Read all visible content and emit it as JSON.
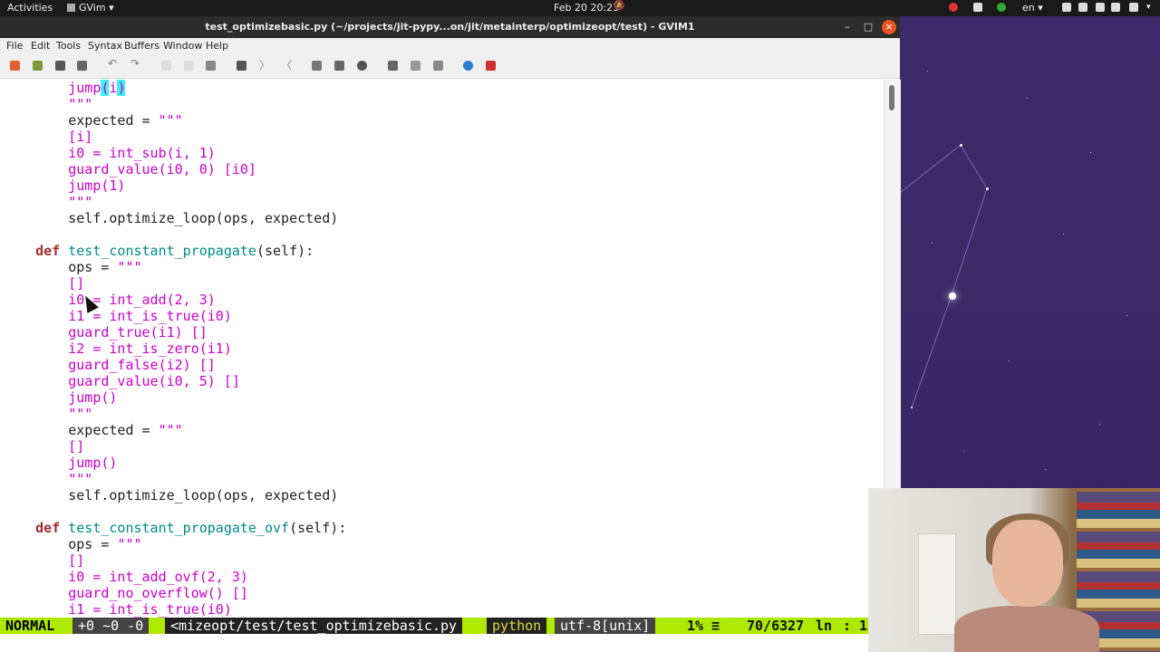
{
  "topbar": {
    "activities": "Activities",
    "app": "GVim ▾",
    "clock": "Feb 20  20:23",
    "language": "en ▾"
  },
  "window": {
    "title": "test_optimizebasic.py (~/projects/jit-pypy...on/jit/metainterp/optimizeopt/test) - GVIM1",
    "minimize": "–",
    "maximize": "□",
    "close": "×"
  },
  "menu": {
    "file": "File",
    "edit": "Edit",
    "tools": "Tools",
    "syntax": "Syntax",
    "buffers": "Buffers",
    "window": "Window",
    "help": "Help"
  },
  "toolbar_icons": [
    "open-icon",
    "save-session-icon",
    "save-icon",
    "print-icon",
    "undo-icon",
    "redo-icon",
    "cut-icon",
    "copy-icon",
    "paste-icon",
    "find-replace-icon",
    "find-next-icon",
    "find-prev-icon",
    "load-session-icon",
    "save-session2-icon",
    "run-script-icon",
    "make-icon",
    "ctags-icon",
    "jump-tag-icon",
    "help-icon",
    "find-help-icon"
  ],
  "code": [
    "        jump(i)",
    "        \"\"\"",
    "        expected = \"\"\"",
    "        [i]",
    "        i0 = int_sub(i, 1)",
    "        guard_value(i0, 0) [i0]",
    "        jump(1)",
    "        \"\"\"",
    "        self.optimize_loop(ops, expected)",
    "",
    "    def test_constant_propagate(self):",
    "        ops = \"\"\"",
    "        []",
    "        i0 = int_add(2, 3)",
    "        i1 = int_is_true(i0)",
    "        guard_true(i1) []",
    "        i2 = int_is_zero(i1)",
    "        guard_false(i2) []",
    "        guard_value(i0, 5) []",
    "        jump()",
    "        \"\"\"",
    "        expected = \"\"\"",
    "        []",
    "        jump()",
    "        \"\"\"",
    "        self.optimize_loop(ops, expected)",
    "",
    "    def test_constant_propagate_ovf(self):",
    "        ops = \"\"\"",
    "        []",
    "        i0 = int_add_ovf(2, 3)",
    "        guard_no_overflow() []",
    "        i1 = int_is_true(i0)"
  ],
  "statusline": {
    "mode": "NORMAL",
    "git": "+0 ~0 -0",
    "file": "<mizeopt/test/test_optimizebasic.py",
    "filetype": "python",
    "encoding": "utf-8[unix]",
    "percent": "1%",
    "equiv": "≡",
    "position": "70/6327",
    "ln": "ln",
    "col": ": 1"
  },
  "colors": {
    "keyword": "#a52a2a",
    "function": "#008b8b",
    "string": "#cc00cc",
    "statusline_mode": "#aeea00",
    "highlight": "#3ff0f0"
  }
}
